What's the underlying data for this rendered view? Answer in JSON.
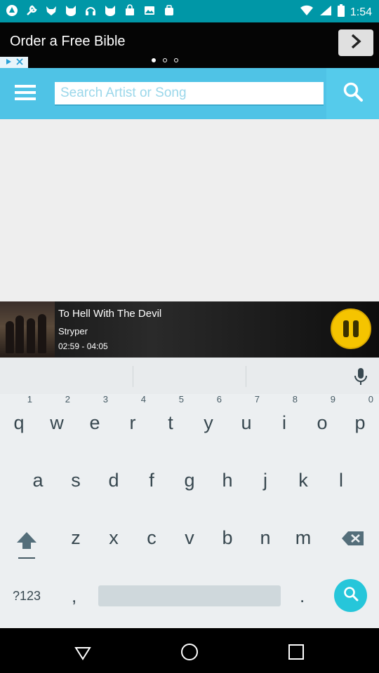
{
  "status_bar": {
    "time": "1:54",
    "notification_icons": [
      "app-icon",
      "tool-icon",
      "fox-icon",
      "cat-icon",
      "headphones-icon",
      "cat-icon",
      "shopping-bag-icon",
      "photo-icon",
      "bag-icon"
    ],
    "right_icons": [
      "wifi-icon",
      "signal-icon",
      "battery-icon"
    ]
  },
  "ad": {
    "title": "Order a Free Bible",
    "pager_dots": 3,
    "active_dot": 0,
    "adchoices_icons": [
      "play-icon",
      "close-icon"
    ],
    "arrow_icon": "chevron-right-icon"
  },
  "toolbar": {
    "menu_icon": "hamburger-menu-icon",
    "search_placeholder": "Search Artist or Song",
    "search_value": "",
    "search_icon": "search-icon",
    "colors": {
      "bar": "#4fc3e6",
      "search_button": "#55cbeb"
    }
  },
  "player": {
    "title": "To Hell With The Devil",
    "artist": "Stryper",
    "time": "02:59 - 04:05",
    "state": "playing",
    "pause_icon": "pause-icon",
    "accent": "#f5c400"
  },
  "keyboard": {
    "rows": [
      [
        {
          "key": "q",
          "hint": "1"
        },
        {
          "key": "w",
          "hint": "2"
        },
        {
          "key": "e",
          "hint": "3"
        },
        {
          "key": "r",
          "hint": "4"
        },
        {
          "key": "t",
          "hint": "5"
        },
        {
          "key": "y",
          "hint": "6"
        },
        {
          "key": "u",
          "hint": "7"
        },
        {
          "key": "i",
          "hint": "8"
        },
        {
          "key": "o",
          "hint": "9"
        },
        {
          "key": "p",
          "hint": "0"
        }
      ],
      [
        {
          "key": "a"
        },
        {
          "key": "s"
        },
        {
          "key": "d"
        },
        {
          "key": "f"
        },
        {
          "key": "g"
        },
        {
          "key": "h"
        },
        {
          "key": "j"
        },
        {
          "key": "k"
        },
        {
          "key": "l"
        }
      ],
      [
        {
          "key": "z"
        },
        {
          "key": "x"
        },
        {
          "key": "c"
        },
        {
          "key": "v"
        },
        {
          "key": "b"
        },
        {
          "key": "n"
        },
        {
          "key": "m"
        }
      ]
    ],
    "symbols_label": "?123",
    "comma_label": ",",
    "period_label": ".",
    "mic_icon": "microphone-icon",
    "shift_icon": "shift-icon",
    "backspace_icon": "backspace-icon",
    "search_icon": "search-icon",
    "accent": "#26c6da"
  },
  "navbar": {
    "icons": [
      "back-icon",
      "home-icon",
      "recents-icon"
    ]
  }
}
